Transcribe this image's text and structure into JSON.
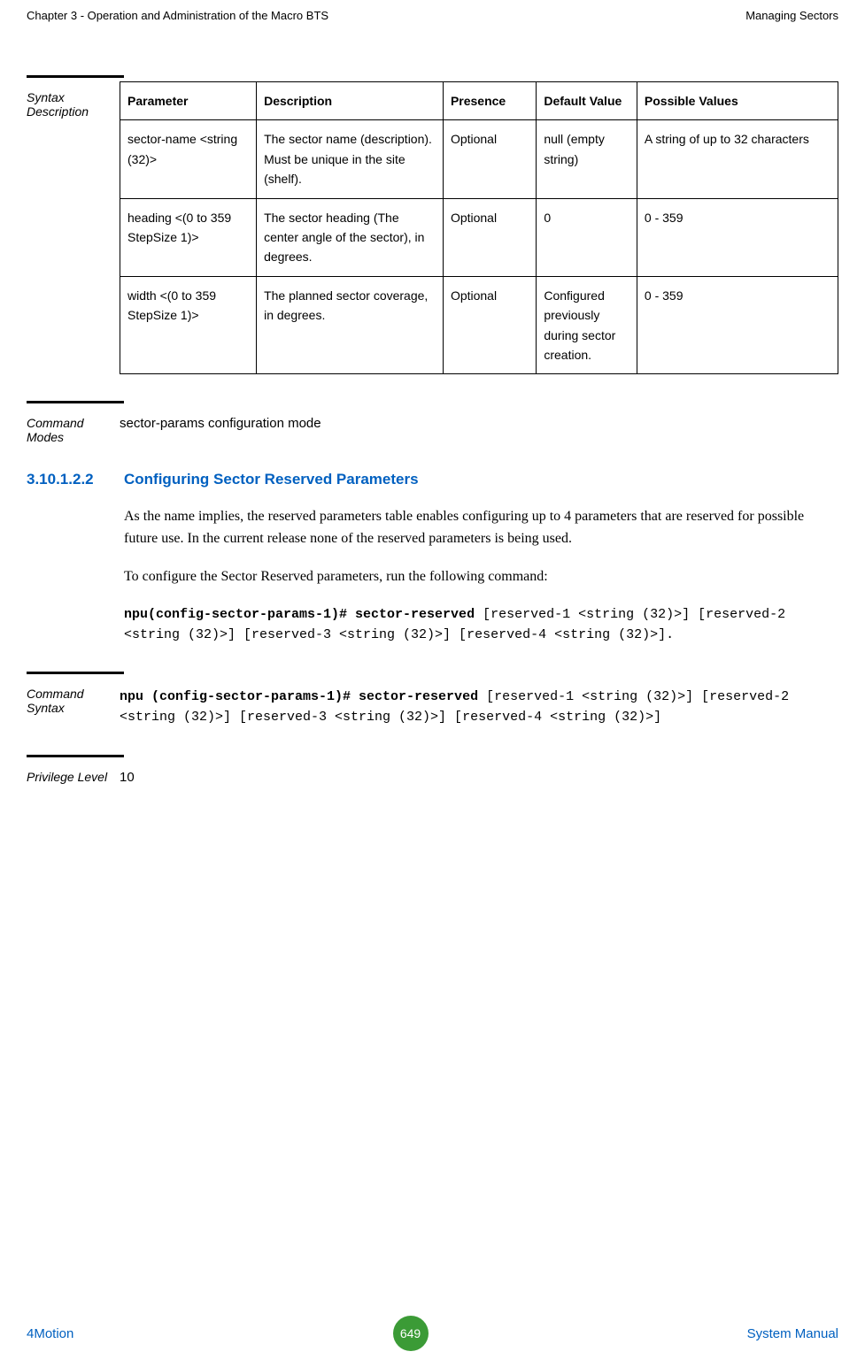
{
  "header": {
    "left": "Chapter 3 - Operation and Administration of the Macro BTS",
    "right": "Managing Sectors"
  },
  "syntax_description": {
    "label": "Syntax Description",
    "cols": {
      "parameter": "Parameter",
      "description": "Description",
      "presence": "Presence",
      "default": "Default Value",
      "possible": "Possible Values"
    },
    "rows": [
      {
        "parameter": "sector-name <string (32)>",
        "description": "The sector name (description). Must be unique in the site (shelf).",
        "presence": "Optional",
        "default": "null (empty string)",
        "possible": "A string of up to 32 characters"
      },
      {
        "parameter": "heading <(0 to 359 StepSize 1)>",
        "description": "The sector heading (The center angle of the sector), in degrees.",
        "presence": "Optional",
        "default": "0",
        "possible": "0 - 359"
      },
      {
        "parameter": "width <(0 to 359 StepSize 1)>",
        "description": "The planned sector coverage, in degrees.",
        "presence": "Optional",
        "default": "Configured previously during sector creation.",
        "possible": "0 - 359"
      }
    ]
  },
  "command_modes": {
    "label": "Command Modes",
    "text": "sector-params configuration mode"
  },
  "section_heading": {
    "number": "3.10.1.2.2",
    "title": "Configuring Sector Reserved Parameters"
  },
  "body": {
    "p1": "As the name implies, the reserved parameters table enables configuring up to 4 parameters that are reserved for possible future use. In the current release none of the reserved parameters is being used.",
    "p2": "To configure the Sector Reserved parameters, run the following command:",
    "cmd1_bold": "npu(config-sector-params-1)# sector-reserved",
    "cmd1_rest": " [reserved-1 <string (32)>] [reserved-2 <string (32)>] [reserved-3 <string (32)>] [reserved-4 <string (32)>]."
  },
  "command_syntax": {
    "label": "Command Syntax",
    "bold": "npu (config-sector-params-1)# sector-reserved",
    "rest": " [reserved-1 <string (32)>] [reserved-2 <string (32)>] [reserved-3 <string (32)>] [reserved-4 <string (32)>]"
  },
  "privilege_level": {
    "label": "Privilege Level",
    "text": "10"
  },
  "footer": {
    "left": "4Motion",
    "page": "649",
    "right": "System Manual"
  }
}
